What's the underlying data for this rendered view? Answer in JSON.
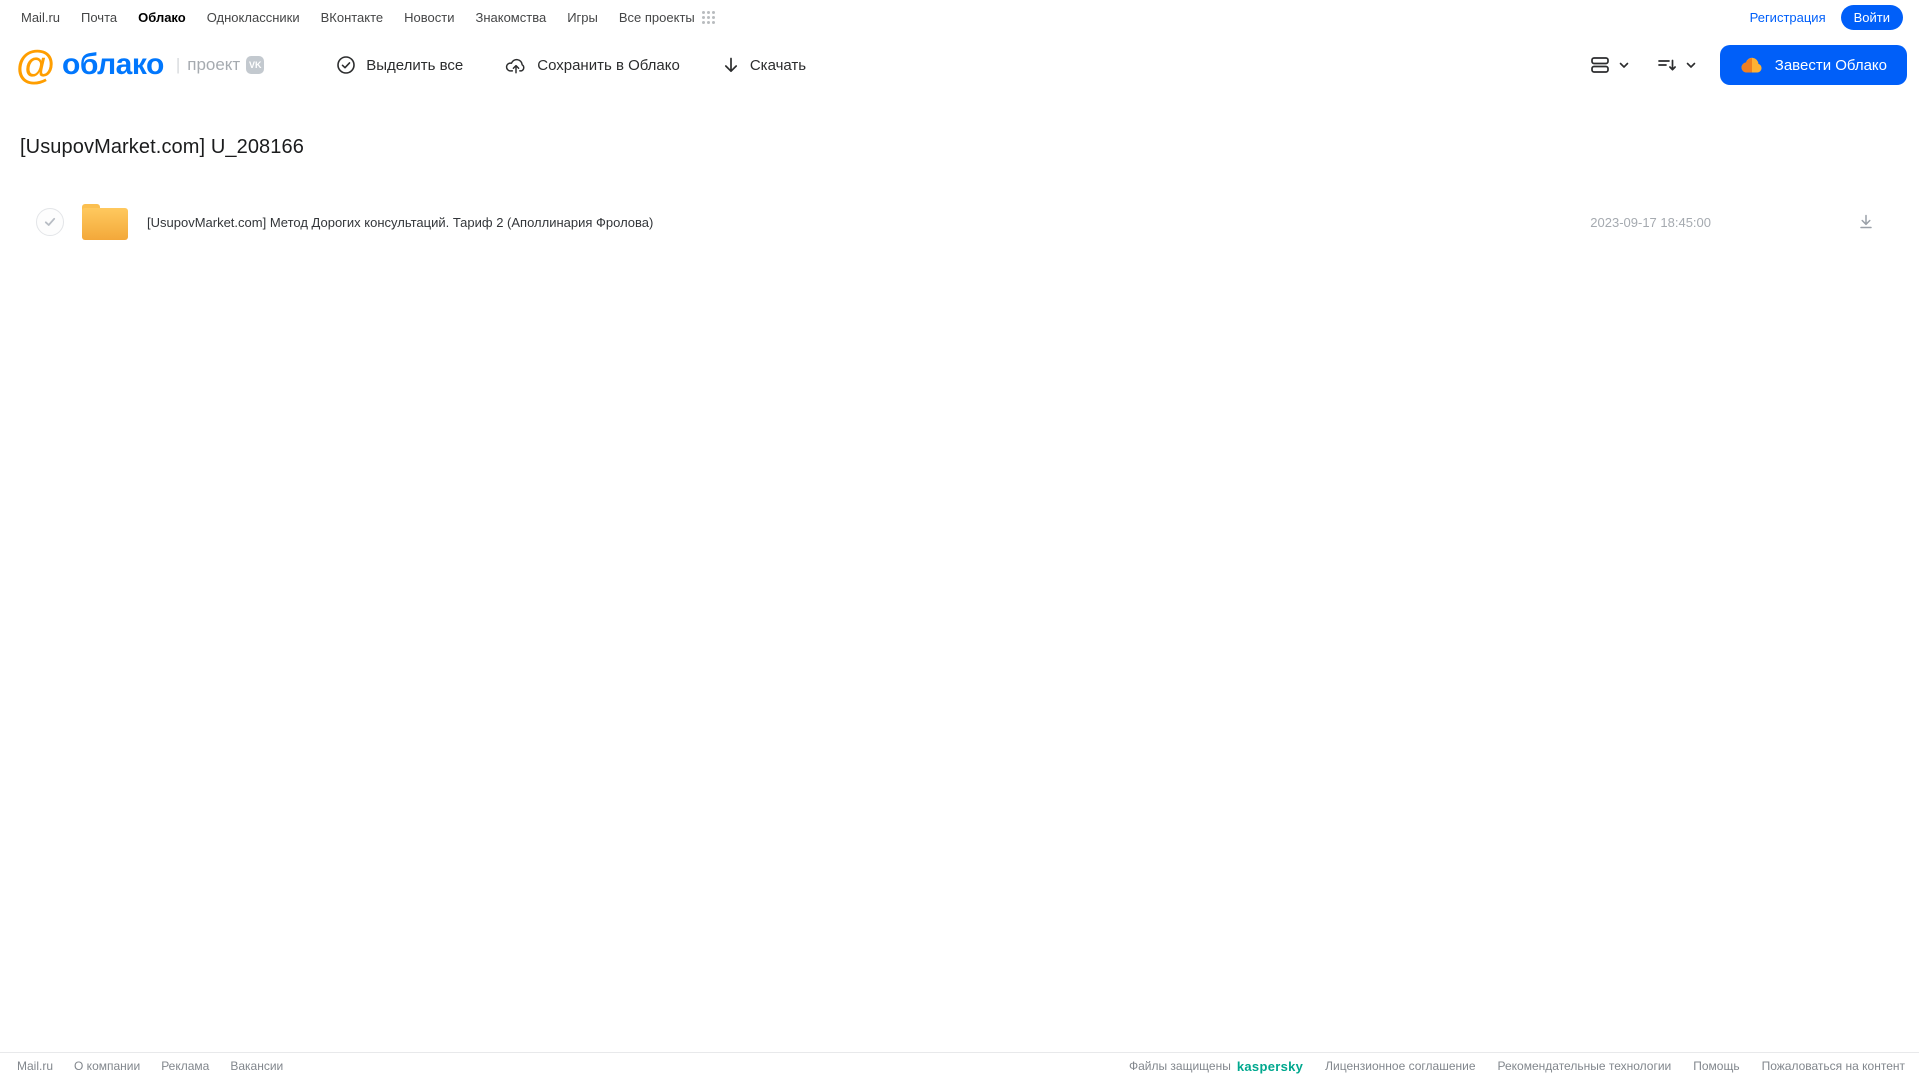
{
  "topbar": {
    "links": [
      "Mail.ru",
      "Почта",
      "Облако",
      "Одноклассники",
      "ВКонтакте",
      "Новости",
      "Знакомства",
      "Игры",
      "Все проекты"
    ],
    "active_link": "Облако",
    "register_label": "Регистрация",
    "login_label": "Войти"
  },
  "header": {
    "logo_at": "@",
    "logo_text": "облако",
    "project_label": "проект",
    "vk_badge": "VK",
    "select_all_label": "Выделить все",
    "save_to_cloud_label": "Сохранить в Облако",
    "download_label": "Скачать",
    "get_cloud_label": "Завести Облако"
  },
  "main": {
    "title": "[UsupovMarket.com] U_208166",
    "file": {
      "type": "folder",
      "name": "[UsupovMarket.com] Метод Дорогих консультаций. Тариф 2 (Аполлинария Фролова)",
      "date": "2023-09-17 18:45:00"
    }
  },
  "footer": {
    "links_left": [
      "Mail.ru",
      "О компании",
      "Реклама",
      "Вакансии"
    ],
    "protected_label": "Файлы защищены",
    "kaspersky_label": "kaspersky",
    "links_right": [
      "Лицензионное соглашение",
      "Рекомендательные технологии",
      "Помощь",
      "Пожаловаться на контент"
    ]
  },
  "colors": {
    "accent_blue": "#005ff9",
    "logo_blue": "#0177fd",
    "logo_orange": "#ff9e00",
    "folder_yellow": "#f5ad3e",
    "kaspersky_teal": "#00a88e"
  }
}
